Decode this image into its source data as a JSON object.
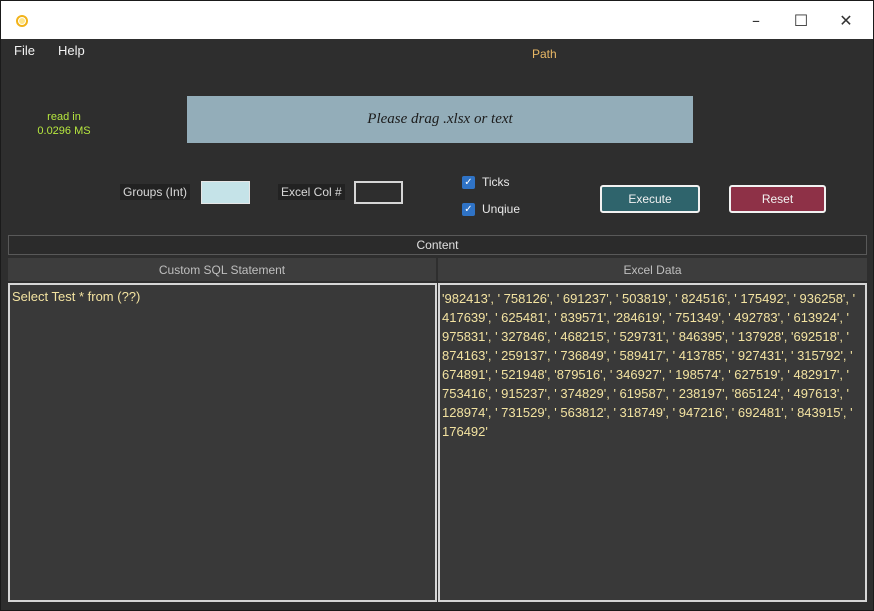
{
  "window": {
    "app_icon": "sun-icon",
    "controls": {
      "minimize": "–",
      "maximize": "☐",
      "close": "✕"
    }
  },
  "menu": {
    "file": "File",
    "help": "Help"
  },
  "path_label": "Path",
  "read_in": {
    "label": "read in",
    "value": "0.0296 MS"
  },
  "drop_zone": {
    "text": "Please drag .xlsx or text"
  },
  "groups": {
    "label": "Groups (Int)",
    "value": ""
  },
  "excel_col": {
    "label": "Excel Col #",
    "value": ""
  },
  "options": {
    "ticks": "Ticks",
    "ticks_checked": true,
    "unique": "Unqiue",
    "unique_checked": true
  },
  "buttons": {
    "execute": "Execute",
    "reset": "Reset"
  },
  "content_header": "Content",
  "columns": {
    "sql": "Custom SQL Statement",
    "excel": "Excel Data"
  },
  "sql_text": "Select Test * from (??)",
  "excel_data": "'982413', ' 758126', ' 691237', ' 503819', ' 824516', ' 175492', ' 936258', ' 417639', ' 625481', ' 839571', '284619', ' 751349', ' 492783', ' 613924', ' 975831', ' 327846', ' 468215', ' 529731', ' 846395', ' 137928', '692518', ' 874163', ' 259137', ' 736849', ' 589417', ' 413785', ' 927431', ' 315792', ' 674891', ' 521948', '879516', ' 346927', ' 198574', ' 627519', ' 482917', ' 753416', ' 915237', ' 374829', ' 619587', ' 238197', '865124', ' 497613', ' 128974', ' 731529', ' 563812', ' 318749', ' 947216', ' 692481', ' 843915', ' 176492'",
  "colors": {
    "path": "#e9b865",
    "read_in": "#b7e83f",
    "drop_zone": "#93adb9",
    "execute": "#2f646c",
    "reset": "#8e3147",
    "pane_text": "#f3e3a1"
  }
}
